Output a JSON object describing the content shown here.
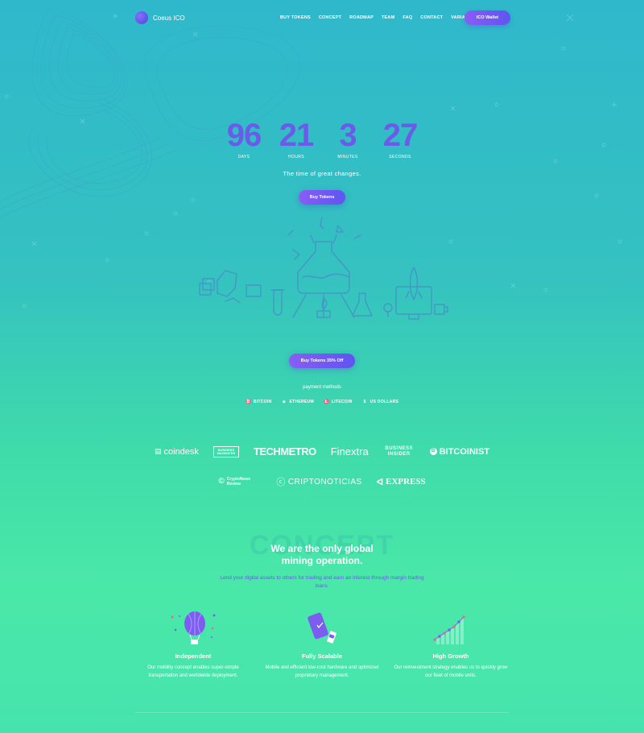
{
  "header": {
    "logo_text": "Coeus ICO",
    "nav": [
      "BUY TOKENS",
      "CONCEPT",
      "ROADMAP",
      "TEAM",
      "FAQ",
      "CONTACT",
      "VARIANTS"
    ],
    "wallet_button": "ICO Wallet"
  },
  "countdown": {
    "days": "96",
    "days_label": "DAYS",
    "hours": "21",
    "hours_label": "HOURS",
    "minutes": "3",
    "minutes_label": "MINUTES",
    "seconds": "27",
    "seconds_label": "SECONDS"
  },
  "hero": {
    "tagline": "The time of great changes.",
    "buy_button": "Buy Tokens",
    "buy_discount_button": "Buy Tokens 35% Off"
  },
  "payment": {
    "title": "payment methods",
    "methods": [
      {
        "label": "BITCOIN",
        "color": "#e86a8a",
        "glyph": "₿"
      },
      {
        "label": "ETHEREUM",
        "color": "#ffffff",
        "glyph": "◆"
      },
      {
        "label": "LITECOIN",
        "color": "#e86a8a",
        "glyph": "Ł"
      },
      {
        "label": "US DOLLARS",
        "color": "#ffffff",
        "glyph": "$"
      }
    ]
  },
  "press": {
    "row1": [
      "coindesk",
      "BUSINESS MAGNATES",
      "TECHMETRO",
      "Finextra",
      "BUSINESS INSIDER",
      "BITCOINIST"
    ],
    "row2": [
      "CryptoNews Review",
      "CRIPTONOTICIAS",
      "EXPRESS"
    ]
  },
  "concept": {
    "bg_word": "CONCEPT",
    "title_line1": "We are the only global",
    "title_line2": "mining operation.",
    "subtitle": "Lend your digital assets to others for trading and earn an interest through margin trading loans.",
    "features": [
      {
        "title": "Independent",
        "desc": "Our mobility concept enables super-simple transportation and worldwide deployment."
      },
      {
        "title": "Fully Scalable",
        "desc": "Mobile and efficient low-cost hardware and optimized proprietary management."
      },
      {
        "title": "High Growth",
        "desc": "Our reinvestment strategy enables us to quickly grow our fleet of mobile units."
      }
    ]
  },
  "colors": {
    "accent": "#6b5be8",
    "button_start": "#8a5cf6",
    "button_end": "#5f55f0"
  }
}
